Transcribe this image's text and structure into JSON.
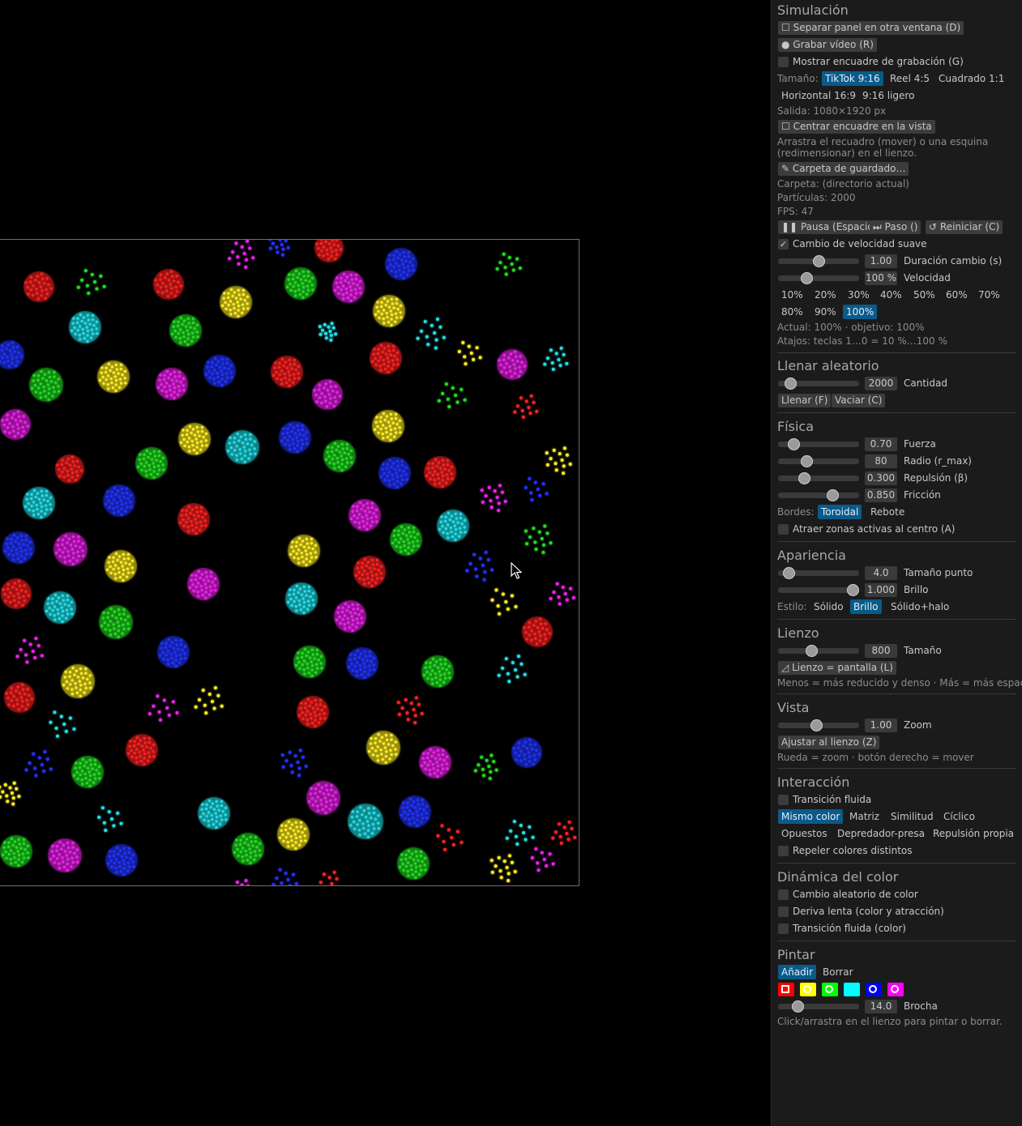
{
  "cursor": "arrow-cursor",
  "panel": {
    "simulacion": {
      "title": "Simulación",
      "detach_btn": "Separar panel en otra ventana (D)",
      "record_btn": "Grabar vídeo (R)",
      "show_frame_cb": "Mostrar encuadre de grabación (G)",
      "size_label": "Tamaño:",
      "size_opts": [
        "TikTok 9:16",
        "Reel 4:5",
        "Cuadrado 1:1",
        "Horizontal 16:9",
        "9:16 ligero"
      ],
      "size_selected": "TikTok 9:16",
      "output": "Salida: 1080×1920 px",
      "center_btn": "Centrar encuadre en la vista",
      "drag_hint_1": "Arrastra el recuadro (mover) o una esquina",
      "drag_hint_2": "(redimensionar) en el lienzo.",
      "folder_btn": "Carpeta de guardado…",
      "folder": "Carpeta: (directorio actual)",
      "particles": "Partículas: 2000",
      "fps": "FPS: 47",
      "pause_btn": "Pausa (Espacio)",
      "step_btn": "Paso ()",
      "restart_btn": "Reiniciar (C)",
      "smooth_cb": "Cambio de velocidad suave",
      "smooth_checked": true,
      "duration_value": "1.00",
      "duration_label": "Duración cambio (s)",
      "speed_value": "100 %",
      "speed_label": "Velocidad",
      "speed_presets": [
        "10%",
        "20%",
        "30%",
        "40%",
        "50%",
        "60%",
        "70%",
        "80%",
        "90%",
        "100%"
      ],
      "speed_selected": "100%",
      "actual": "Actual: 100% · objetivo: 100%",
      "shortcuts": "Atajos: teclas 1…0 = 10 %…100 %"
    },
    "llenar": {
      "title": "Llenar aleatorio",
      "cantidad_value": "2000",
      "cantidad_label": "Cantidad",
      "fill_btn": "Llenar (F)",
      "empty_btn": "Vaciar (C)"
    },
    "fisica": {
      "title": "Física",
      "sliders": [
        {
          "value": "0.70",
          "label": "Fuerza"
        },
        {
          "value": "80",
          "label": "Radio (r_max)"
        },
        {
          "value": "0.300",
          "label": "Repulsión (β)"
        },
        {
          "value": "0.850",
          "label": "Fricción"
        }
      ],
      "borders_label": "Bordes:",
      "borders_opts": [
        "Toroidal",
        "Rebote"
      ],
      "borders_selected": "Toroidal",
      "attract_cb": "Atraer zonas activas al centro (A)"
    },
    "apariencia": {
      "title": "Apariencia",
      "point_value": "4.0",
      "point_label": "Tamaño punto",
      "bright_value": "1.000",
      "bright_label": "Brillo",
      "style_label": "Estilo:",
      "style_opts": [
        "Sólido",
        "Brillo",
        "Sólido+halo"
      ],
      "style_selected": "Brillo"
    },
    "lienzo": {
      "title": "Lienzo",
      "size_value": "800",
      "size_label": "Tamaño",
      "screen_btn": "Lienzo = pantalla (L)",
      "hint": "Menos = más reducido y denso · Más = más espacio"
    },
    "vista": {
      "title": "Vista",
      "zoom_value": "1.00",
      "zoom_label": "Zoom",
      "fit_btn": "Ajustar al lienzo (Z)",
      "hint": "Rueda = zoom · botón derecho = mover"
    },
    "interaccion": {
      "title": "Interacción",
      "fluid_cb": "Transición fluida",
      "modes": [
        "Mismo color",
        "Matriz",
        "Similitud",
        "Cíclico",
        "Opuestos",
        "Depredador-presa",
        "Repulsión propia"
      ],
      "mode_selected": "Mismo color",
      "repel_cb": "Repeler colores distintos"
    },
    "dinamica": {
      "title": "Dinámica del color",
      "cbs": [
        "Cambio aleatorio de color",
        "Deriva lenta (color y atracción)",
        "Transición fluida (color)"
      ]
    },
    "pintar": {
      "title": "Pintar",
      "modes": [
        "Añadir",
        "Borrar"
      ],
      "mode_selected": "Añadir",
      "colors": [
        "#ff0000",
        "#ffff00",
        "#00ff00",
        "#00ffff",
        "#0000ff",
        "#ff00ff"
      ],
      "brush_value": "14.0",
      "brush_label": "Brocha",
      "hint": "Click/arrastra en el lienzo para pintar o borrar."
    }
  }
}
